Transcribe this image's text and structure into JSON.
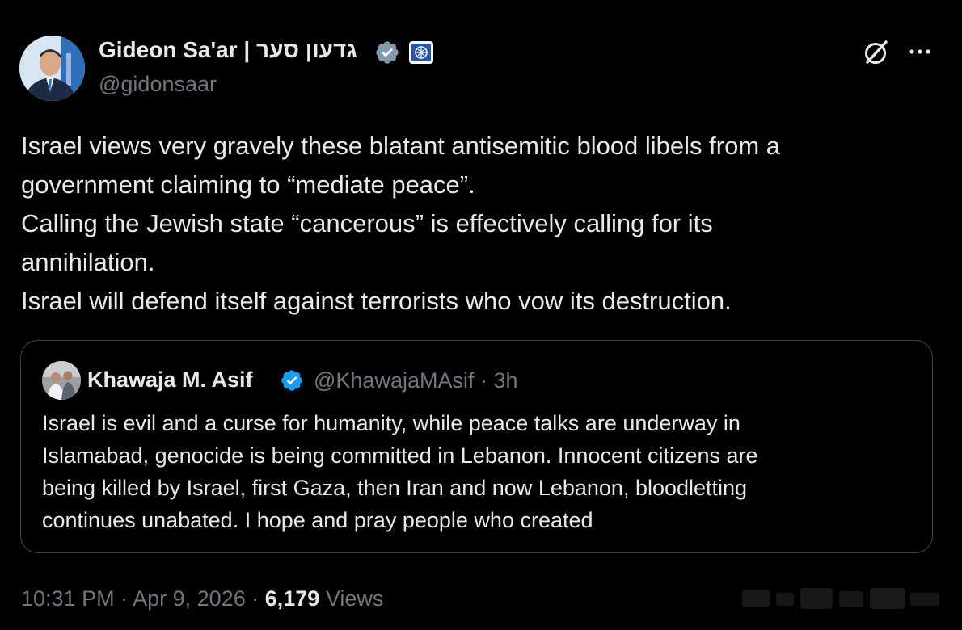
{
  "author": {
    "name": "Gideon Sa'ar | גדעון סער",
    "handle": "@gidonsaar",
    "verified_color": "#829aab"
  },
  "header_icons": {
    "grok": "grok-icon",
    "more": "more-icon"
  },
  "tweet": {
    "lines": [
      "Israel views very gravely these blatant antisemitic blood libels from a",
      "government claiming to “mediate peace”.",
      "Calling the Jewish state “cancerous” is effectively calling for its",
      "annihilation.",
      "Israel will defend itself against terrorists who vow its destruction."
    ]
  },
  "quote": {
    "name": "Khawaja M. Asif",
    "handle": "@KhawajaMAsif",
    "separator": "·",
    "time": "3h",
    "verified_color": "#1d9bf0",
    "lines": [
      "Israel is evil and a curse for humanity, while peace talks are underway in",
      "Islamabad, genocide is being committed in Lebanon. Innocent citizens are",
      "being killed by Israel, first Gaza, then Iran and now Lebanon, bloodletting",
      "continues unabated. I hope and pray people who created"
    ]
  },
  "footer": {
    "time": "10:31 PM",
    "sep1": "·",
    "date": "Apr 9, 2026",
    "sep2": "·",
    "views_count": "6,179",
    "views_label": "Views"
  }
}
